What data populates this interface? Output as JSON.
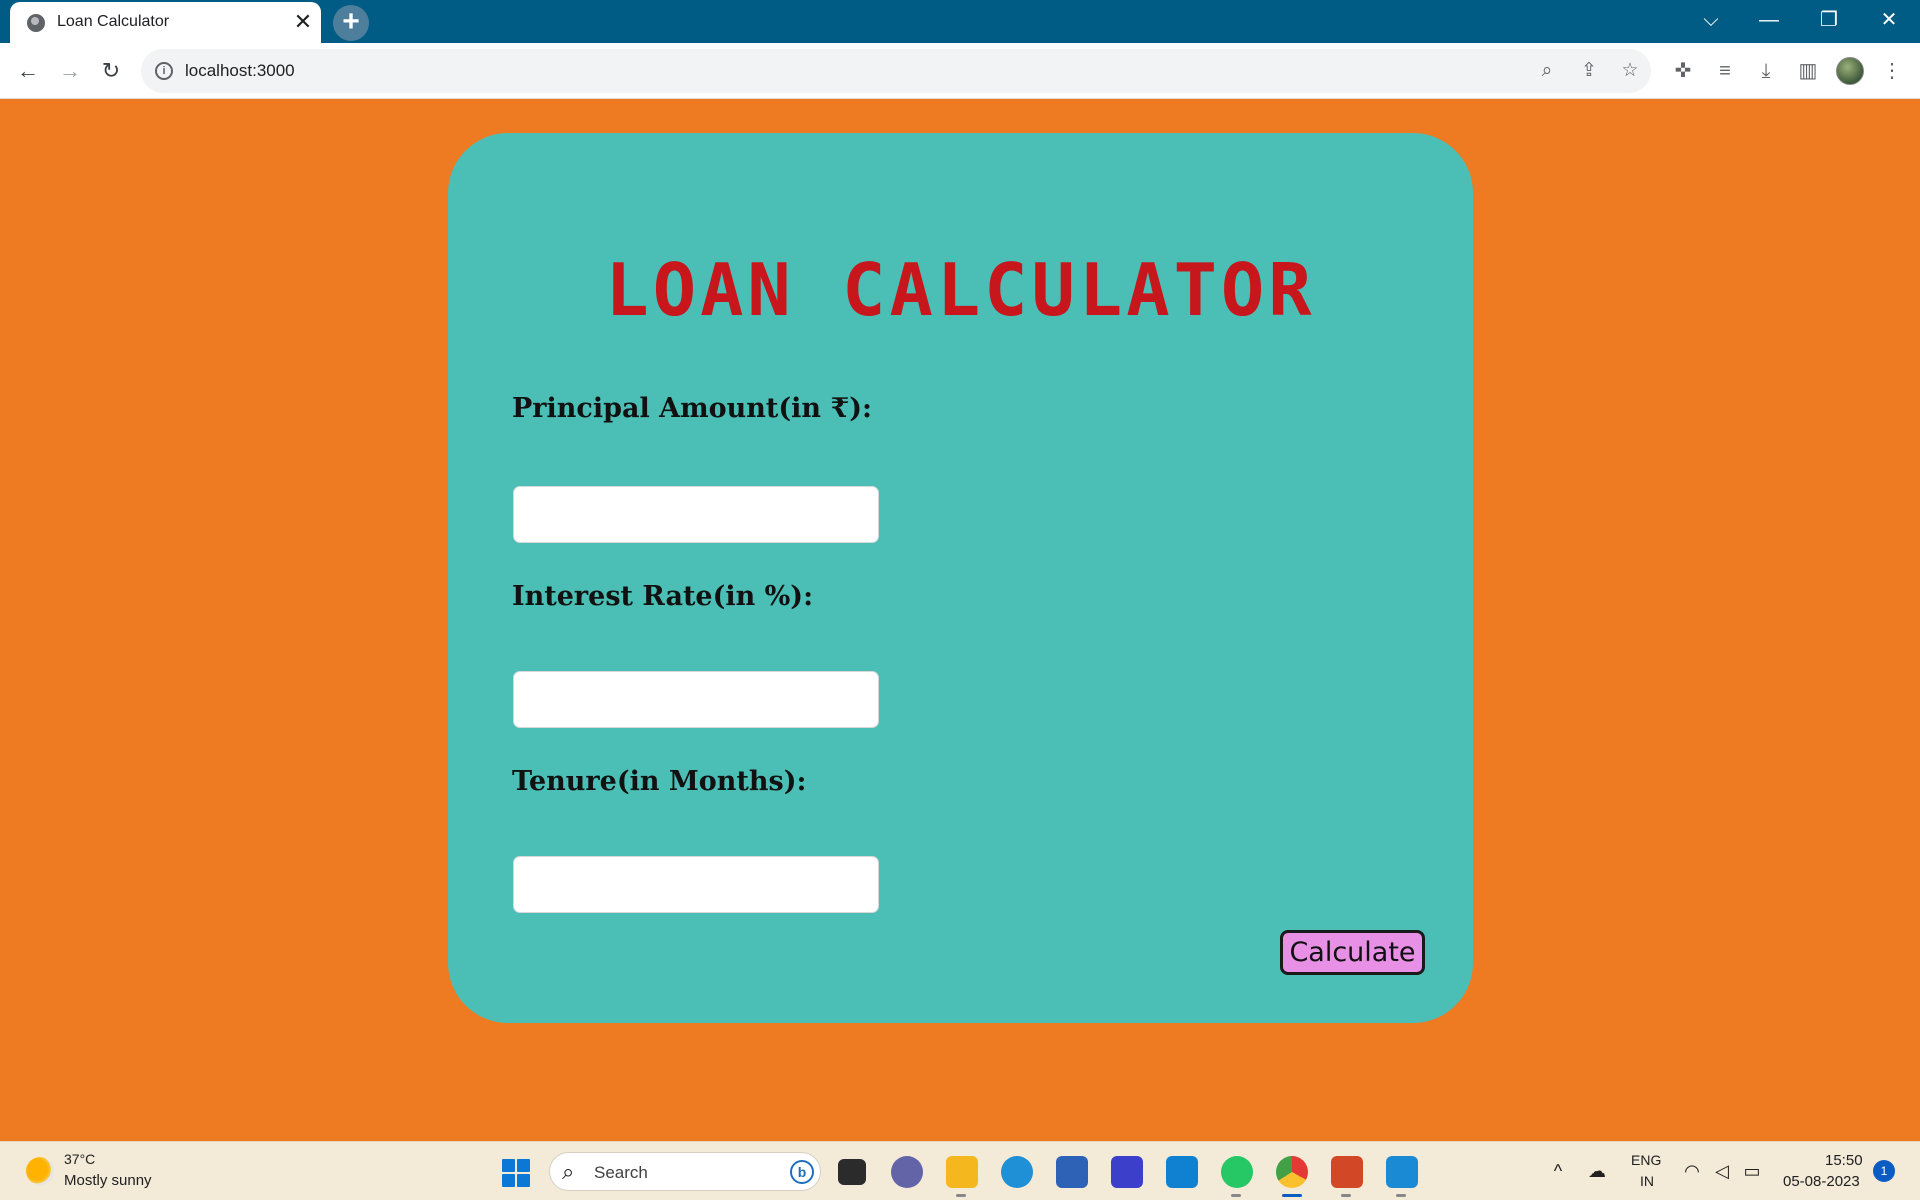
{
  "browser": {
    "tab_title": "Loan Calculator",
    "tab_close_glyph": "✕",
    "new_tab_glyph": "+",
    "url": "localhost:3000",
    "icons": [
      "back-arrow-icon",
      "forward-arrow-icon",
      "reload-icon",
      "site-info-icon",
      "zoom-icon",
      "share-icon",
      "bookmark-star-icon",
      "extensions-icon",
      "reading-list-icon",
      "download-icon",
      "side-panel-icon",
      "profile-avatar",
      "more-menu-icon"
    ]
  },
  "window_controls": {
    "tab_list": "⌵",
    "minimize": "—",
    "restore": "❐",
    "close": "✕"
  },
  "page": {
    "heading": "LOAN CALCULATOR",
    "principal_label": "Principal Amount(in ₹):",
    "principal_value": "",
    "interest_label": "Interest Rate(in %):",
    "interest_value": "",
    "tenure_label": "Tenure(in Months):",
    "tenure_value": "",
    "calculate_label": "Calculate"
  },
  "colors": {
    "page_background": "#ee7b22",
    "card_background": "#4bbeb6",
    "heading": "#c8161d",
    "button_background": "#e890e6",
    "titlebar": "#005c84"
  },
  "taskbar": {
    "weather_temp": "37°C",
    "weather_desc": "Mostly sunny",
    "search_placeholder": "Search",
    "language_top": "ENG",
    "language_bottom": "IN",
    "time": "15:50",
    "date": "05-08-2023",
    "notification_count": "1",
    "apps": [
      "windows-start-icon",
      "task-view-icon",
      "teams-icon",
      "file-explorer-icon",
      "edge-icon",
      "microsoft-store-icon",
      "app-icon",
      "cortana-icon",
      "whatsapp-icon",
      "chrome-icon",
      "powerpoint-icon",
      "vscode-icon"
    ]
  }
}
